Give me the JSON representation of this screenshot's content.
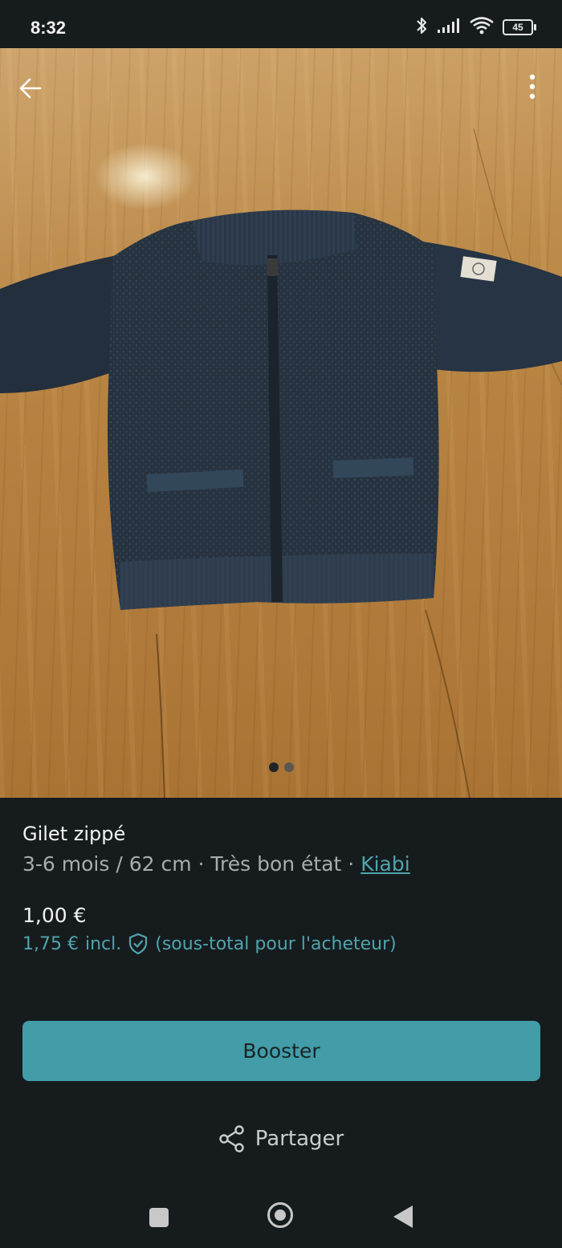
{
  "status_bar": {
    "time": "8:32",
    "battery": "45",
    "icons": [
      "bluetooth-icon",
      "signal-icon",
      "wifi-icon",
      "battery-icon"
    ]
  },
  "gallery": {
    "image_description_icon": "knit-cardigan-photo",
    "page_count": 2,
    "current_page": 1
  },
  "item": {
    "title": "Gilet zippé",
    "meta_prefix": "3-6 mois / 62 cm · Très bon état · ",
    "brand": "Kiabi"
  },
  "pricing": {
    "price": "1,00 €",
    "incl_price": "1,75 €",
    "incl_label": "incl.",
    "incl_note": "(sous-total pour l'acheteur)"
  },
  "actions": {
    "booster_label": "Booster",
    "share_label": "Partager"
  },
  "colors": {
    "background": "#161c1e",
    "accent": "#429da8",
    "link": "#4fa4ad"
  }
}
